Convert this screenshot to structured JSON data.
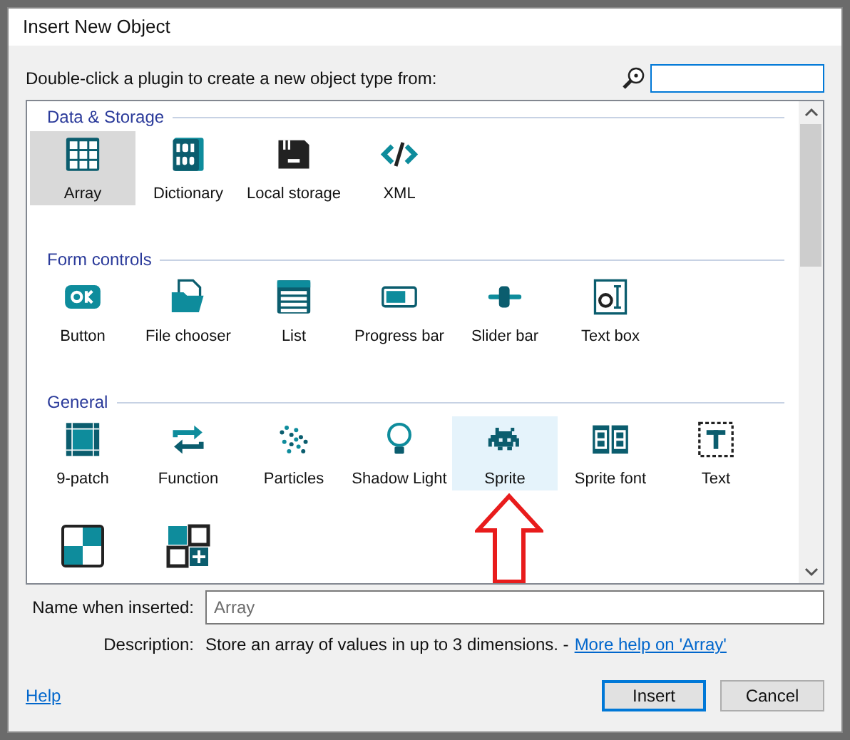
{
  "window": {
    "title": "Insert New Object"
  },
  "prompt": "Double-click a plugin to create a new object type from:",
  "categories": [
    {
      "title": "Data & Storage",
      "items": [
        {
          "label": "Array",
          "selected": true,
          "hovered": false
        },
        {
          "label": "Dictionary",
          "selected": false,
          "hovered": false
        },
        {
          "label": "Local storage",
          "selected": false,
          "hovered": false
        },
        {
          "label": "XML",
          "selected": false,
          "hovered": false
        }
      ]
    },
    {
      "title": "Form controls",
      "items": [
        {
          "label": "Button",
          "selected": false,
          "hovered": false
        },
        {
          "label": "File chooser",
          "selected": false,
          "hovered": false
        },
        {
          "label": "List",
          "selected": false,
          "hovered": false
        },
        {
          "label": "Progress bar",
          "selected": false,
          "hovered": false
        },
        {
          "label": "Slider bar",
          "selected": false,
          "hovered": false
        },
        {
          "label": "Text box",
          "selected": false,
          "hovered": false
        }
      ]
    },
    {
      "title": "General",
      "items": [
        {
          "label": "9-patch",
          "selected": false,
          "hovered": false
        },
        {
          "label": "Function",
          "selected": false,
          "hovered": false
        },
        {
          "label": "Particles",
          "selected": false,
          "hovered": false
        },
        {
          "label": "Shadow Light",
          "selected": false,
          "hovered": false
        },
        {
          "label": "Sprite",
          "selected": false,
          "hovered": true
        },
        {
          "label": "Sprite font",
          "selected": false,
          "hovered": false
        },
        {
          "label": "Text",
          "selected": false,
          "hovered": false
        },
        {
          "selected": false,
          "hovered": false
        },
        {
          "selected": false,
          "hovered": false
        }
      ]
    }
  ],
  "name_field": {
    "label": "Name when inserted:",
    "placeholder": "Array"
  },
  "description": {
    "label": "Description:",
    "text": "Store an array of values in up to 3 dimensions. -",
    "link": "More help on 'Array'"
  },
  "help_link": "Help",
  "buttons": [
    {
      "label": "Insert",
      "default": true
    },
    {
      "label": "Cancel",
      "default": false
    }
  ]
}
